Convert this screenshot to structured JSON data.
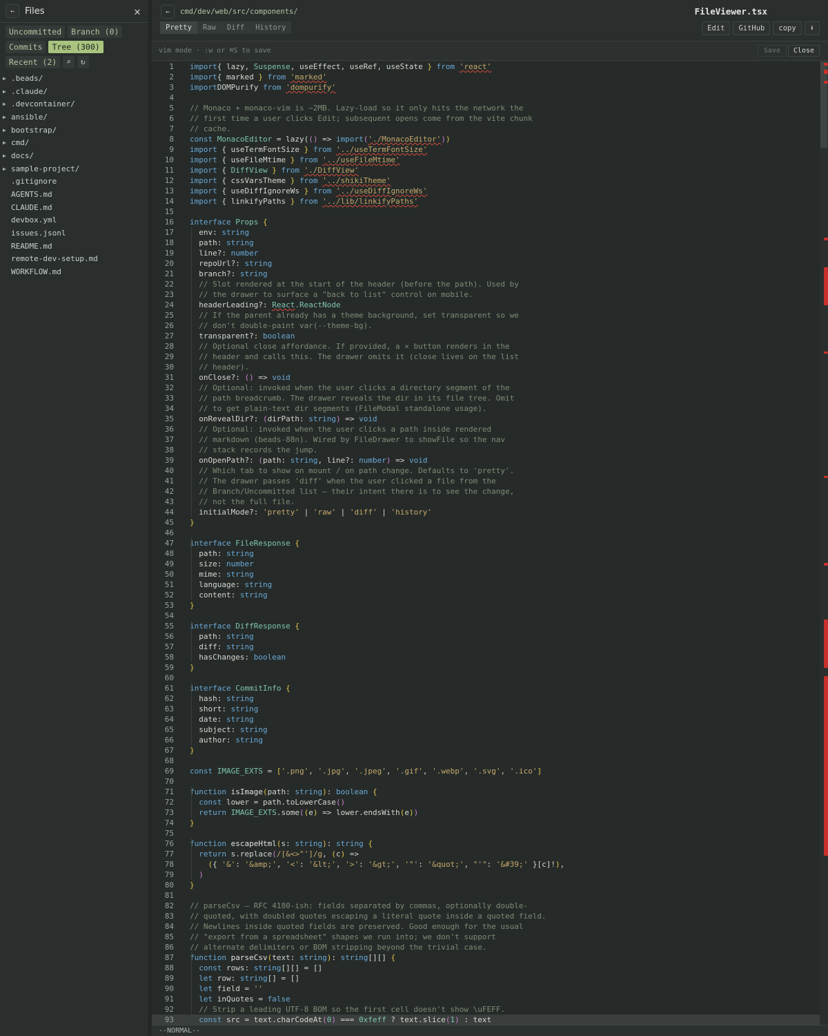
{
  "sidebar": {
    "title": "Files",
    "chips_row1": [
      "Uncommitted",
      "Branch (0)"
    ],
    "chips_row2": [
      "Commits",
      "Tree (300)"
    ],
    "chips_row3": [
      "Recent (2)"
    ],
    "tree": [
      {
        "name": ".beads/",
        "dir": true
      },
      {
        "name": ".claude/",
        "dir": true
      },
      {
        "name": ".devcontainer/",
        "dir": true
      },
      {
        "name": "ansible/",
        "dir": true
      },
      {
        "name": "bootstrap/",
        "dir": true
      },
      {
        "name": "cmd/",
        "dir": true
      },
      {
        "name": "docs/",
        "dir": true
      },
      {
        "name": "sample-project/",
        "dir": true
      },
      {
        "name": ".gitignore",
        "dir": false
      },
      {
        "name": "AGENTS.md",
        "dir": false
      },
      {
        "name": "CLAUDE.md",
        "dir": false
      },
      {
        "name": "devbox.yml",
        "dir": false
      },
      {
        "name": "issues.jsonl",
        "dir": false
      },
      {
        "name": "README.md",
        "dir": false
      },
      {
        "name": "remote-dev-setup.md",
        "dir": false
      },
      {
        "name": "WORKFLOW.md",
        "dir": false
      }
    ]
  },
  "viewer": {
    "path": "cmd/dev/web/src/components/",
    "file_name": "FileViewer.tsx",
    "tabs": [
      "Pretty",
      "Raw",
      "Diff",
      "History"
    ],
    "active_tab": "Pretty",
    "actions": [
      "Edit",
      "GitHub",
      "copy"
    ],
    "vim_hint": "vim mode · :w or ⌘S to save",
    "save_label": "Save",
    "close_label": "Close",
    "status": "--NORMAL--"
  },
  "code_lines": [
    [
      [
        "kw",
        "import"
      ],
      [
        "",
        "{ lazy, "
      ],
      [
        "cls",
        "Suspense"
      ],
      [
        "",
        ", useEffect, useRef, useState "
      ],
      [
        "br",
        "}"
      ],
      [
        "kw",
        " from "
      ],
      [
        "str err",
        "'react'"
      ]
    ],
    [
      [
        "kw",
        "import"
      ],
      [
        "",
        "{ marked "
      ],
      [
        "br",
        "}"
      ],
      [
        "kw",
        " from "
      ],
      [
        "str err",
        "'marked'"
      ]
    ],
    [
      [
        "kw",
        "import"
      ],
      [
        "",
        ""
      ],
      [
        "",
        ""
      ],
      [
        "",
        "DOMPurify"
      ],
      [
        "kw",
        " from "
      ],
      [
        "str err",
        "'dompurify'"
      ]
    ],
    [],
    [
      [
        "cm",
        "// Monaco + monaco-vim is ~2MB. Lazy-load so it only hits the network the"
      ]
    ],
    [
      [
        "cm",
        "// first time a user clicks Edit; subsequent opens come from the vite chunk"
      ]
    ],
    [
      [
        "cm",
        "// cache."
      ]
    ],
    [
      [
        "kw",
        "const "
      ],
      [
        "cls",
        "MonacoEditor"
      ],
      [
        "",
        " = lazy("
      ],
      [
        "pn",
        "()"
      ],
      [
        "",
        " => "
      ],
      [
        "kw",
        "import"
      ],
      [
        "pn",
        "("
      ],
      [
        "str err",
        "'./MonacoEditor'"
      ],
      [
        "pn",
        ")"
      ],
      [
        "br",
        ")"
      ]
    ],
    [
      [
        "kw",
        "import"
      ],
      [
        "",
        " { useTermFontSize "
      ],
      [
        "br",
        "}"
      ],
      [
        "kw",
        " from "
      ],
      [
        "str err",
        "'../useTermFontSize'"
      ]
    ],
    [
      [
        "kw",
        "import"
      ],
      [
        "",
        " { useFileMtime "
      ],
      [
        "br",
        "}"
      ],
      [
        "kw",
        " from "
      ],
      [
        "str err",
        "'../useFileMtime'"
      ]
    ],
    [
      [
        "kw",
        "import"
      ],
      [
        "",
        " { "
      ],
      [
        "cls",
        "DiffView"
      ],
      [
        "",
        " "
      ],
      [
        "br",
        "}"
      ],
      [
        "kw",
        " from "
      ],
      [
        "str err",
        "'./DiffView'"
      ]
    ],
    [
      [
        "kw",
        "import"
      ],
      [
        "",
        " { cssVarsTheme "
      ],
      [
        "br",
        "}"
      ],
      [
        "kw",
        " from "
      ],
      [
        "str err",
        "'../shikiTheme'"
      ]
    ],
    [
      [
        "kw",
        "import"
      ],
      [
        "",
        " { useDiffIgnoreWs "
      ],
      [
        "br",
        "}"
      ],
      [
        "kw",
        " from "
      ],
      [
        "str err",
        "'../useDiffIgnoreWs'"
      ]
    ],
    [
      [
        "kw",
        "import"
      ],
      [
        "",
        " { linkifyPaths "
      ],
      [
        "br",
        "}"
      ],
      [
        "kw",
        " from "
      ],
      [
        "str err",
        "'../lib/linkifyPaths'"
      ]
    ],
    [],
    [
      [
        "kw",
        "interface "
      ],
      [
        "cls",
        "Props"
      ],
      [
        "",
        " "
      ],
      [
        "br",
        "{"
      ]
    ],
    [
      [
        "",
        "  env: "
      ],
      [
        "ty",
        "string"
      ]
    ],
    [
      [
        "",
        "  path: "
      ],
      [
        "ty",
        "string"
      ]
    ],
    [
      [
        "",
        "  line?: "
      ],
      [
        "ty",
        "number"
      ]
    ],
    [
      [
        "",
        "  repoUrl?: "
      ],
      [
        "ty",
        "string"
      ]
    ],
    [
      [
        "",
        "  branch?: "
      ],
      [
        "ty",
        "string"
      ]
    ],
    [
      [
        "cm",
        "  // Slot rendered at the start of the header (before the path). Used by"
      ]
    ],
    [
      [
        "cm",
        "  // the drawer to surface a \"back to list\" control on mobile."
      ]
    ],
    [
      [
        "",
        "  headerLeading?: "
      ],
      [
        "cls err",
        "React"
      ],
      [
        "",
        ""
      ],
      [
        "cls",
        ".ReactNode"
      ]
    ],
    [
      [
        "cm",
        "  // If the parent already has a theme background, set transparent so we"
      ]
    ],
    [
      [
        "cm",
        "  // don't double-paint var(--theme-bg)."
      ]
    ],
    [
      [
        "",
        "  transparent?: "
      ],
      [
        "ty",
        "boolean"
      ]
    ],
    [
      [
        "cm",
        "  // Optional close affordance. If provided, a × button renders in the"
      ]
    ],
    [
      [
        "cm",
        "  // header and calls this. The drawer omits it (close lives on the list"
      ]
    ],
    [
      [
        "cm",
        "  // header)."
      ]
    ],
    [
      [
        "",
        "  onClose?: "
      ],
      [
        "pn",
        "()"
      ],
      [
        "",
        " => "
      ],
      [
        "ty",
        "void"
      ]
    ],
    [
      [
        "cm",
        "  // Optional: invoked when the user clicks a directory segment of the"
      ]
    ],
    [
      [
        "cm",
        "  // path breadcrumb. The drawer reveals the dir in its file tree. Omit"
      ]
    ],
    [
      [
        "cm",
        "  // to get plain-text dir segments (FileModal standalone usage)."
      ]
    ],
    [
      [
        "",
        "  onRevealDir?: "
      ],
      [
        "pn",
        "("
      ],
      [
        "",
        "dirPath: "
      ],
      [
        "ty",
        "string"
      ],
      [
        "pn",
        ")"
      ],
      [
        "",
        " => "
      ],
      [
        "ty",
        "void"
      ]
    ],
    [
      [
        "cm",
        "  // Optional: invoked when the user clicks a path inside rendered"
      ]
    ],
    [
      [
        "cm",
        "  // markdown (beads-88n). Wired by FileDrawer to showFile so the nav"
      ]
    ],
    [
      [
        "cm",
        "  // stack records the jump."
      ]
    ],
    [
      [
        "",
        "  onOpenPath?: "
      ],
      [
        "pn",
        "("
      ],
      [
        "",
        "path: "
      ],
      [
        "ty",
        "string"
      ],
      [
        "",
        ", line?: "
      ],
      [
        "ty",
        "number"
      ],
      [
        "pn",
        ")"
      ],
      [
        "",
        " => "
      ],
      [
        "ty",
        "void"
      ]
    ],
    [
      [
        "cm",
        "  // Which tab to show on mount / on path change. Defaults to 'pretty'."
      ]
    ],
    [
      [
        "cm",
        "  // The drawer passes 'diff' when the user clicked a file from the"
      ]
    ],
    [
      [
        "cm",
        "  // Branch/Uncommitted list — their intent there is to see the change,"
      ]
    ],
    [
      [
        "cm",
        "  // not the full file."
      ]
    ],
    [
      [
        "",
        "  initialMode?: "
      ],
      [
        "str",
        "'pretty'"
      ],
      [
        "",
        " | "
      ],
      [
        "str",
        "'raw'"
      ],
      [
        "",
        " | "
      ],
      [
        "str",
        "'diff'"
      ],
      [
        "",
        " | "
      ],
      [
        "str",
        "'history'"
      ]
    ],
    [
      [
        "br",
        "}"
      ]
    ],
    [],
    [
      [
        "kw",
        "interface "
      ],
      [
        "cls",
        "FileResponse"
      ],
      [
        "",
        " "
      ],
      [
        "br",
        "{"
      ]
    ],
    [
      [
        "",
        "  path: "
      ],
      [
        "ty",
        "string"
      ]
    ],
    [
      [
        "",
        "  size: "
      ],
      [
        "ty",
        "number"
      ]
    ],
    [
      [
        "",
        "  mime: "
      ],
      [
        "ty",
        "string"
      ]
    ],
    [
      [
        "",
        "  language: "
      ],
      [
        "ty",
        "string"
      ]
    ],
    [
      [
        "",
        "  content: "
      ],
      [
        "ty",
        "string"
      ]
    ],
    [
      [
        "br",
        "}"
      ]
    ],
    [],
    [
      [
        "kw",
        "interface "
      ],
      [
        "cls",
        "DiffResponse"
      ],
      [
        "",
        " "
      ],
      [
        "br",
        "{"
      ]
    ],
    [
      [
        "",
        "  path: "
      ],
      [
        "ty",
        "string"
      ]
    ],
    [
      [
        "",
        "  diff: "
      ],
      [
        "ty",
        "string"
      ]
    ],
    [
      [
        "",
        "  hasChanges: "
      ],
      [
        "ty",
        "boolean"
      ]
    ],
    [
      [
        "br",
        "}"
      ]
    ],
    [],
    [
      [
        "kw",
        "interface "
      ],
      [
        "cls",
        "CommitInfo"
      ],
      [
        "",
        " "
      ],
      [
        "br",
        "{"
      ]
    ],
    [
      [
        "",
        "  hash: "
      ],
      [
        "ty",
        "string"
      ]
    ],
    [
      [
        "",
        "  short: "
      ],
      [
        "ty",
        "string"
      ]
    ],
    [
      [
        "",
        "  date: "
      ],
      [
        "ty",
        "string"
      ]
    ],
    [
      [
        "",
        "  subject: "
      ],
      [
        "ty",
        "string"
      ]
    ],
    [
      [
        "",
        "  author: "
      ],
      [
        "ty",
        "string"
      ]
    ],
    [
      [
        "br",
        "}"
      ]
    ],
    [],
    [
      [
        "kw",
        "const "
      ],
      [
        "cls",
        "IMAGE_EXTS"
      ],
      [
        "",
        " = "
      ],
      [
        "br",
        "["
      ],
      [
        "str",
        "'.png'"
      ],
      [
        "",
        ", "
      ],
      [
        "str",
        "'.jpg'"
      ],
      [
        "",
        ", "
      ],
      [
        "str",
        "'.jpeg'"
      ],
      [
        "",
        ", "
      ],
      [
        "str",
        "'.gif'"
      ],
      [
        "",
        ", "
      ],
      [
        "str",
        "'.webp'"
      ],
      [
        "",
        ", "
      ],
      [
        "str",
        "'.svg'"
      ],
      [
        "",
        ", "
      ],
      [
        "str",
        "'.ico'"
      ],
      [
        "br",
        "]"
      ]
    ],
    [],
    [
      [
        "kw",
        "function "
      ],
      [
        "fn",
        "isImage"
      ],
      [
        "br",
        "("
      ],
      [
        "",
        "path: "
      ],
      [
        "ty",
        "string"
      ],
      [
        "br",
        ")"
      ],
      [
        "",
        ": "
      ],
      [
        "ty",
        "boolean"
      ],
      [
        "",
        " "
      ],
      [
        "br",
        "{"
      ]
    ],
    [
      [
        "kw",
        "  const "
      ],
      [
        "",
        "lower = path.toLowerCase"
      ],
      [
        "pn",
        "()"
      ]
    ],
    [
      [
        "kw",
        "  return "
      ],
      [
        "cls",
        "IMAGE_EXTS"
      ],
      [
        "",
        ".some"
      ],
      [
        "pn",
        "("
      ],
      [
        "br",
        "("
      ],
      [
        "",
        "e"
      ],
      [
        "br",
        ")"
      ],
      [
        "",
        " => lower.endsWith"
      ],
      [
        "br",
        "("
      ],
      [
        "",
        "e"
      ],
      [
        "br",
        ")"
      ],
      [
        "pn",
        ")"
      ]
    ],
    [
      [
        "br",
        "}"
      ]
    ],
    [],
    [
      [
        "kw",
        "function "
      ],
      [
        "fn",
        "escapeHtml"
      ],
      [
        "br",
        "("
      ],
      [
        "",
        "s: "
      ],
      [
        "ty",
        "string"
      ],
      [
        "br",
        ")"
      ],
      [
        "",
        ": "
      ],
      [
        "ty",
        "string"
      ],
      [
        "",
        " "
      ],
      [
        "br",
        "{"
      ]
    ],
    [
      [
        "kw",
        "  return "
      ],
      [
        "",
        "s.replace"
      ],
      [
        "pn",
        "("
      ],
      [
        "str",
        "/[&<>\"']/g"
      ],
      [
        "",
        ", "
      ],
      [
        "br",
        "("
      ],
      [
        "",
        "c"
      ],
      [
        "br",
        ")"
      ],
      [
        "",
        " =>"
      ]
    ],
    [
      [
        "",
        "    "
      ],
      [
        "br",
        "("
      ],
      [
        "",
        "{ "
      ],
      [
        "str",
        "'&'"
      ],
      [
        "",
        ": "
      ],
      [
        "str",
        "'&amp;'"
      ],
      [
        "",
        ", "
      ],
      [
        "str",
        "'<'"
      ],
      [
        "",
        ": "
      ],
      [
        "str",
        "'&lt;'"
      ],
      [
        "",
        ", "
      ],
      [
        "str",
        "'>'"
      ],
      [
        "",
        ": "
      ],
      [
        "str",
        "'&gt;'"
      ],
      [
        "",
        ", "
      ],
      [
        "str",
        "'\"'"
      ],
      [
        "",
        ": "
      ],
      [
        "str",
        "'&quot;'"
      ],
      [
        "",
        ", "
      ],
      [
        "str",
        "\"'\""
      ],
      [
        "",
        ": "
      ],
      [
        "str",
        "'&#39;'"
      ],
      [
        "",
        " }[c]!"
      ],
      [
        "br",
        ")"
      ],
      [
        "",
        ","
      ]
    ],
    [
      [
        "pn",
        "  )"
      ]
    ],
    [
      [
        "br",
        "}"
      ]
    ],
    [],
    [
      [
        "cm",
        "// parseCsv — RFC 4180-ish: fields separated by commas, optionally double-"
      ]
    ],
    [
      [
        "cm",
        "// quoted, with doubled quotes escaping a literal quote inside a quoted field."
      ]
    ],
    [
      [
        "cm",
        "// Newlines inside quoted fields are preserved. Good enough for the usual"
      ]
    ],
    [
      [
        "cm",
        "// \"export from a spreadsheet\" shapes we run into; we don't support"
      ]
    ],
    [
      [
        "cm",
        "// alternate delimiters or BOM stripping beyond the trivial case."
      ]
    ],
    [
      [
        "kw",
        "function "
      ],
      [
        "fn",
        "parseCsv"
      ],
      [
        "br",
        "("
      ],
      [
        "",
        "text: "
      ],
      [
        "ty",
        "string"
      ],
      [
        "br",
        ")"
      ],
      [
        "",
        ": "
      ],
      [
        "ty",
        "string"
      ],
      [
        "",
        "[][] "
      ],
      [
        "br",
        "{"
      ]
    ],
    [
      [
        "kw",
        "  const "
      ],
      [
        "",
        "rows: "
      ],
      [
        "ty",
        "string"
      ],
      [
        "",
        "[][] = []"
      ]
    ],
    [
      [
        "kw",
        "  let "
      ],
      [
        "",
        "row: "
      ],
      [
        "ty",
        "string"
      ],
      [
        "",
        "[] = []"
      ]
    ],
    [
      [
        "kw",
        "  let "
      ],
      [
        "",
        "field = "
      ],
      [
        "str",
        "''"
      ]
    ],
    [
      [
        "kw",
        "  let "
      ],
      [
        "",
        "inQuotes = "
      ],
      [
        "ty",
        "false"
      ]
    ],
    [
      [
        "cm",
        "  // Strip a leading UTF-8 BOM so the first cell doesn't show \\uFEFF."
      ]
    ],
    [
      [
        "kw",
        "  const "
      ],
      [
        "",
        "src = text.charCodeAt"
      ],
      [
        "pn",
        "("
      ],
      [
        "cls",
        "0"
      ],
      [
        "pn",
        ")"
      ],
      [
        "",
        " === "
      ],
      [
        "cls",
        "0xfeff"
      ],
      [
        "",
        " ? text.slice"
      ],
      [
        "pn",
        "("
      ],
      [
        "cls",
        "1"
      ],
      [
        "pn",
        ")"
      ],
      [
        "",
        " : text"
      ]
    ]
  ]
}
